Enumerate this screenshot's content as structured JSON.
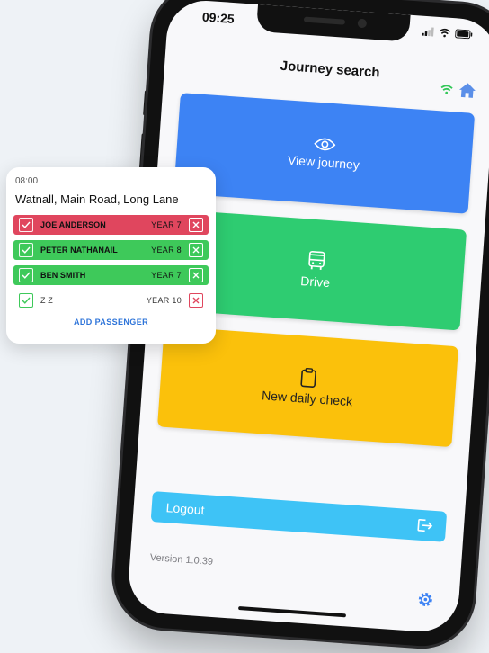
{
  "phone": {
    "status_time": "09:25",
    "app_title": "Journey search",
    "cards": {
      "view": "View journey",
      "drive": "Drive",
      "check": "New daily check"
    },
    "logout": "Logout",
    "version": "Version 1.0.39",
    "colors": {
      "view": "#3d83f4",
      "drive": "#2ecc71",
      "check": "#fbc10b",
      "logout": "#3ec3f6"
    }
  },
  "passenger_card": {
    "time": "08:00",
    "route": "Watnall, Main Road, Long Lane",
    "rows": [
      {
        "name": "JOE ANDERSON",
        "year": "YEAR 7",
        "state": "red"
      },
      {
        "name": "PETER NATHANAIL",
        "year": "YEAR 8",
        "state": "green"
      },
      {
        "name": "BEN SMITH",
        "year": "YEAR 7",
        "state": "green"
      },
      {
        "name": "Z Z",
        "year": "YEAR 10",
        "state": "plain"
      }
    ],
    "add_label": "ADD PASSENGER",
    "icons": {
      "check": "check-icon",
      "cross": "x-icon"
    }
  }
}
